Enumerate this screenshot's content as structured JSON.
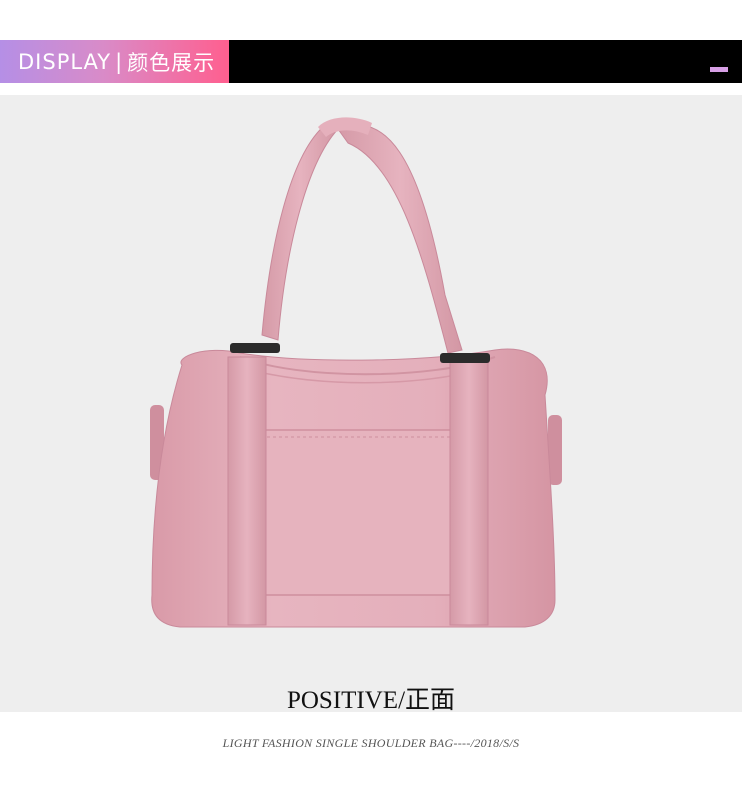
{
  "header": {
    "label_en": "DISPLAY",
    "separator": "|",
    "label_cn": "颜色展示"
  },
  "product": {
    "name": "pink shoulder bag",
    "color": "#e3aeb9"
  },
  "captions": {
    "main": "POSITIVE/正面",
    "sub": "LIGHT FASHION SINGLE SHOULDER BAG----/2018/S/S"
  },
  "colors": {
    "header_bg": "#000000",
    "header_gradient_start": "#b58fe6",
    "header_gradient_end": "#ff5f8f",
    "photo_bg": "#eeeeee",
    "bag_pink": "#e3aeb9"
  }
}
